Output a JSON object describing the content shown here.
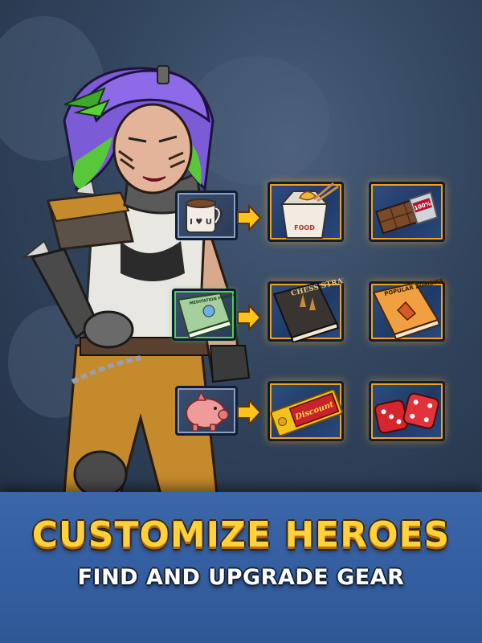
{
  "banner": {
    "title": "CUSTOMIZE HEROES",
    "subtitle": "FIND AND UPGRADE GEAR"
  },
  "colors": {
    "title": "#ffd23a",
    "banner": "#3560a3",
    "slot_glow": "#f2a21a"
  },
  "upgrade_rows": [
    {
      "source_item": {
        "name": "mug-icon",
        "label": "I ♥ U"
      },
      "results": [
        {
          "name": "takeout-box-icon",
          "label": "FOOD"
        },
        {
          "name": "chocolate-bar-icon",
          "label": "100%"
        }
      ]
    },
    {
      "source_item": {
        "name": "book-meditation-icon",
        "label": "MEDITATION MINDFULNESS"
      },
      "results": [
        {
          "name": "chess-book-icon",
          "label": "CHESS STRATEGY"
        },
        {
          "name": "zombies-book-icon",
          "label": "POPULAR ZOMBIES"
        }
      ]
    },
    {
      "source_item": {
        "name": "piggy-bank-icon",
        "label": ""
      },
      "results": [
        {
          "name": "discount-ticket-icon",
          "label": "Discount"
        },
        {
          "name": "dice-icon",
          "label": ""
        }
      ]
    }
  ]
}
